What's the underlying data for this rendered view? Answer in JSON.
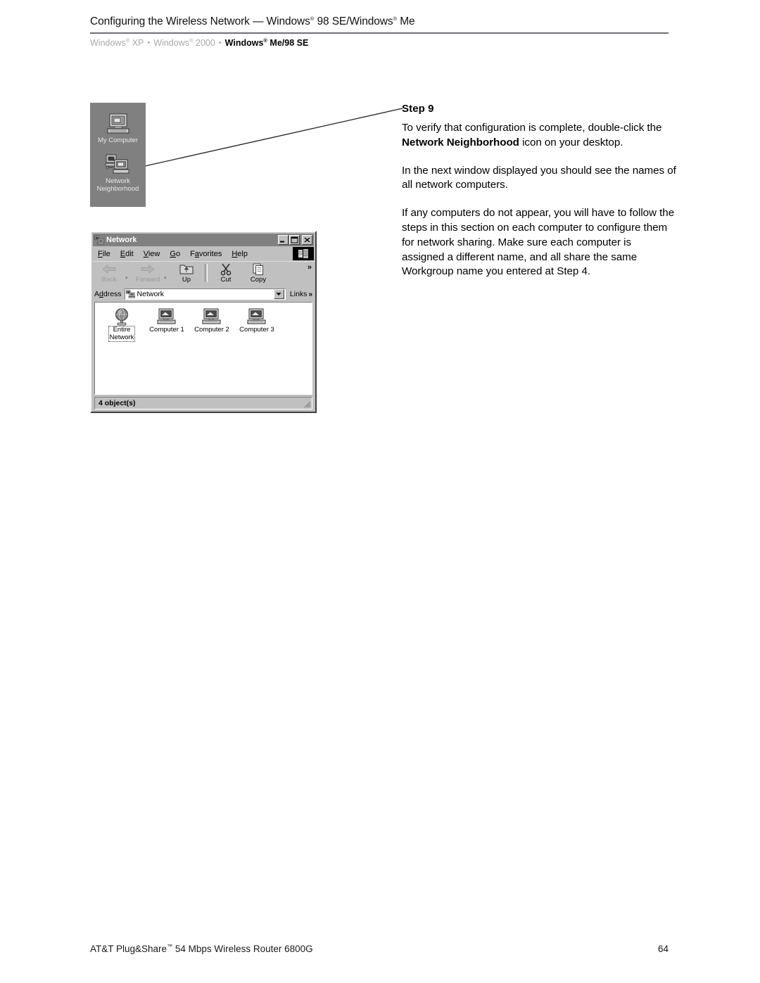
{
  "header": {
    "title_pre": "Configuring the Wireless Network — Windows",
    "title_mid": " 98 SE/Windows",
    "title_post": " Me",
    "breadcrumb": [
      {
        "label_pre": "Windows",
        "label_post": " XP",
        "active": false
      },
      {
        "label_pre": "Windows",
        "label_post": " 2000",
        "active": false
      },
      {
        "label_pre": "Windows",
        "label_post": " Me/98 SE",
        "active": true
      }
    ],
    "separator": "•"
  },
  "desktop": {
    "background_color": "#808080",
    "icons": [
      {
        "name": "my-computer",
        "label": "My Computer"
      },
      {
        "name": "network-neighborhood",
        "label_line1": "Network",
        "label_line2": "Neighborhood"
      }
    ]
  },
  "explorer_window": {
    "title": "Network",
    "title_icon": "network-neighborhood-icon",
    "controls": {
      "minimize": "minimize-button",
      "maximize": "maximize-button",
      "close": "close-button"
    },
    "menu": [
      {
        "pre": "",
        "mnemonic": "F",
        "post": "ile"
      },
      {
        "pre": "",
        "mnemonic": "E",
        "post": "dit"
      },
      {
        "pre": "",
        "mnemonic": "V",
        "post": "iew"
      },
      {
        "pre": "",
        "mnemonic": "G",
        "post": "o"
      },
      {
        "pre": "",
        "mnemonic": "F",
        "post": "avorites"
      },
      {
        "pre": "",
        "mnemonic": "H",
        "post": "elp"
      }
    ],
    "toolbar": {
      "buttons": [
        {
          "label": "Back",
          "icon": "back-arrow-icon",
          "disabled": true,
          "has_dropdown": true
        },
        {
          "label": "Forward",
          "icon": "forward-arrow-icon",
          "disabled": true,
          "has_dropdown": true
        },
        {
          "label": "Up",
          "icon": "up-folder-icon",
          "disabled": false,
          "has_dropdown": false
        },
        {
          "label": "Cut",
          "icon": "scissors-icon",
          "disabled": false,
          "has_dropdown": false
        },
        {
          "label": "Copy",
          "icon": "copy-pages-icon",
          "disabled": false,
          "has_dropdown": false
        }
      ],
      "overflow": "»"
    },
    "address_bar": {
      "label": "Address",
      "label_mnemonic": "d",
      "value": "Network",
      "icon": "network-neighborhood-icon",
      "dropdown_icon": "chevron-down-icon",
      "links_label": "Links",
      "links_chevron": "»"
    },
    "items": [
      {
        "label_line1": "Entire",
        "label_line2": "Network",
        "icon": "globe-icon",
        "selected": true
      },
      {
        "label": "Computer 1",
        "icon": "computer-icon",
        "selected": false
      },
      {
        "label": "Computer 2",
        "icon": "computer-icon",
        "selected": false
      },
      {
        "label": "Computer 3",
        "icon": "computer-icon",
        "selected": false
      }
    ],
    "status_bar": {
      "text": "4 object(s)",
      "grip": "resize-grip-icon"
    }
  },
  "content": {
    "step_heading": "Step 9",
    "paragraph1_a": "To verify that configuration is complete, double-click the ",
    "paragraph1_bold": "Network Neighborhood",
    "paragraph1_b": " icon on your desktop.",
    "paragraph2": "In the next window displayed you should see the names of all network computers.",
    "paragraph3": "If any computers do not appear, you will have to follow the steps in this section on each computer to configure them for network sharing. Make sure each computer is assigned a different name, and all share the same Workgroup name you entered at Step 4."
  },
  "footer": {
    "product_pre": "AT&T Plug&Share",
    "product_post": " 54 Mbps Wireless Router 6800G",
    "page_number": "64"
  }
}
